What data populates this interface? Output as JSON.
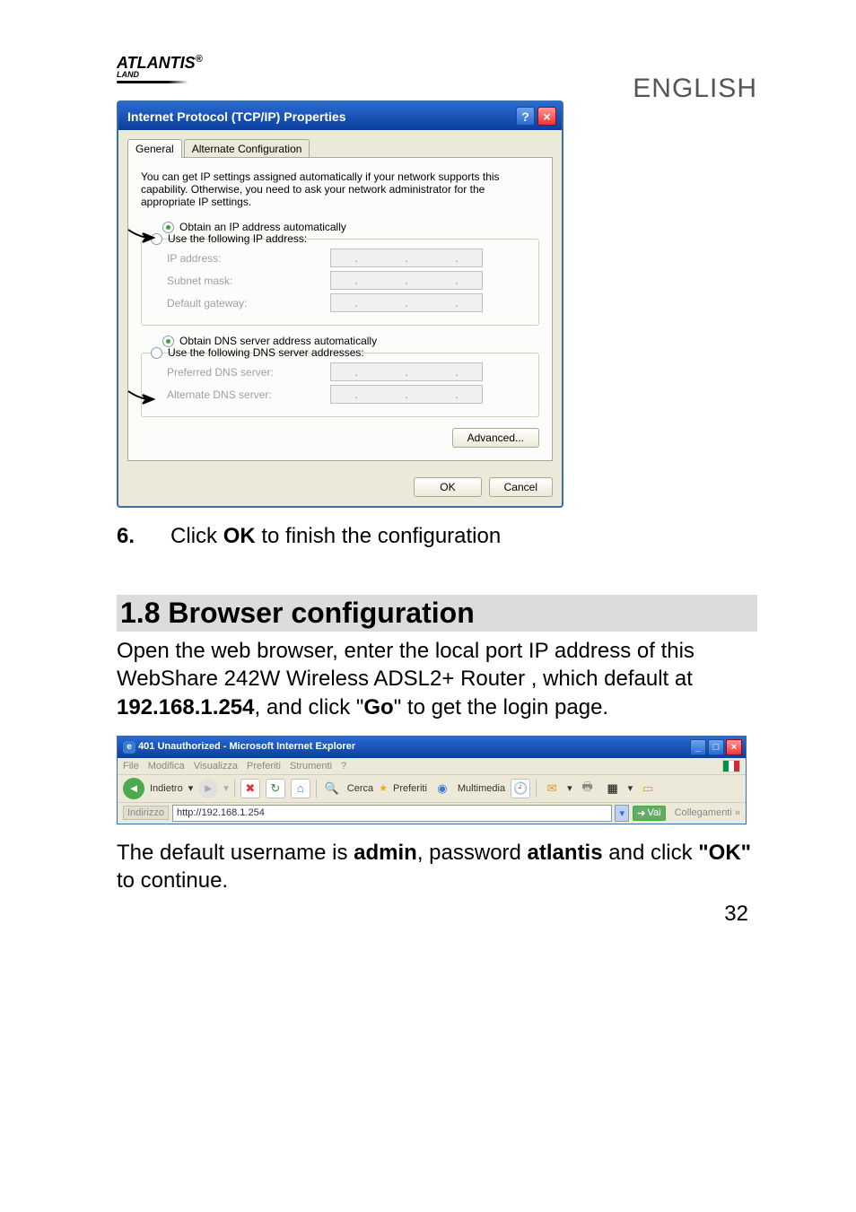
{
  "header": {
    "logo": "ATLANTIS",
    "logo_sub": "LAND",
    "language_label": "ENGLISH"
  },
  "dialog": {
    "title": "Internet Protocol (TCP/IP) Properties",
    "tabs": {
      "general": "General",
      "alternate": "Alternate Configuration"
    },
    "info_text": "You can get IP settings assigned automatically if your network supports this capability. Otherwise, you need to ask your network administrator for the appropriate IP settings.",
    "ip_group": {
      "obtain_auto": "Obtain an IP address automatically",
      "use_following": "Use the following IP address:",
      "ip_label": "IP address:",
      "subnet_label": "Subnet mask:",
      "gateway_label": "Default gateway:"
    },
    "dns_group": {
      "obtain_auto": "Obtain DNS server address automatically",
      "use_following": "Use the following DNS server addresses:",
      "preferred_label": "Preferred DNS server:",
      "alternate_label": "Alternate DNS server:"
    },
    "advanced_btn": "Advanced...",
    "ok_btn": "OK",
    "cancel_btn": "Cancel"
  },
  "step6": {
    "num": "6.",
    "text_before": "Click ",
    "bold": "OK",
    "text_after": " to finish the configuration"
  },
  "section": {
    "heading": "1.8 Browser configuration",
    "p1_a": "Open the web browser, enter the local port IP address of this WebShare 242W Wireless ADSL2+ Router , which default at ",
    "p1_ip": "192.168.1.254",
    "p1_b": ", and click \"",
    "p1_go": "Go",
    "p1_c": "\" to get the login page."
  },
  "browser": {
    "title": "401 Unauthorized - Microsoft Internet Explorer",
    "menu": {
      "file": "File",
      "modifica": "Modifica",
      "visualizza": "Visualizza",
      "preferiti": "Preferiti",
      "strumenti": "Strumenti",
      "help": "?"
    },
    "toolbar": {
      "indietro": "Indietro",
      "cerca": "Cerca",
      "preferiti": "Preferiti",
      "multimedia": "Multimedia"
    },
    "address": {
      "label": "Indirizzo",
      "url": "http://192.168.1.254",
      "go": "Vai",
      "links": "Collegamenti"
    }
  },
  "after_browser": {
    "a": "The default username is ",
    "admin": "admin",
    "b": ", password ",
    "pw": "atlantis",
    "c": " and click ",
    "ok": "\"OK\"",
    "d": " to continue."
  },
  "page_number": "32"
}
